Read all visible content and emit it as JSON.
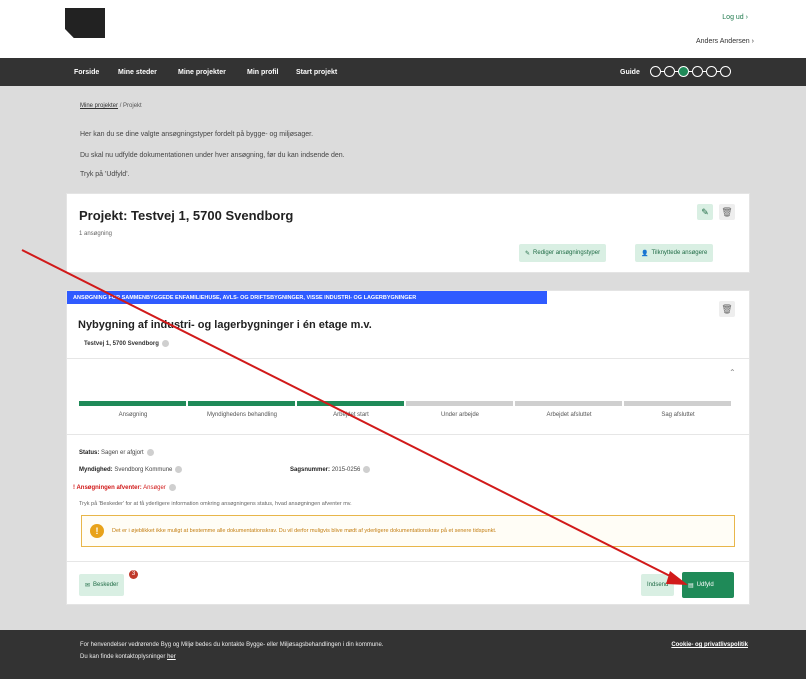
{
  "header": {
    "logout_label": "Log ud",
    "user_name": "Anders Andersen"
  },
  "nav": {
    "items": [
      {
        "label": "Forside"
      },
      {
        "label": "Mine steder"
      },
      {
        "label": "Mine projekter"
      },
      {
        "label": "Min profil"
      },
      {
        "label": "Start projekt"
      }
    ],
    "guide_label": "Guide",
    "guide_steps": 6,
    "guide_active_step": 3
  },
  "breadcrumb": {
    "link": "Mine projekter",
    "separator": "/",
    "current": "Projekt"
  },
  "intro": {
    "line1": "Her kan du se dine valgte ansøgningstyper fordelt på bygge- og miljøsager.",
    "line2": "Du skal nu udfylde dokumentationen under hver ansøgning, før du kan indsende den.",
    "line3": "Tryk på 'Udfyld'."
  },
  "project": {
    "title": "Projekt: Testvej 1, 5700 Svendborg",
    "count": "1 ansøgning",
    "edit_types_label": "Rediger ansøgningstyper",
    "linked_applicants_label": "Tilknyttede ansøgere"
  },
  "application": {
    "banner": "ANSØGNING FOR SAMMENBYGGEDE ENFAMILIEHUSE, AVLS- OG DRIFTSBYGNINGER, VISSE INDUSTRI- OG LAGERBYGNINGER",
    "title": "Nybygning af industri- og lagerbygninger i én etage m.v.",
    "address": "Testvej 1, 5700 Svendborg",
    "progress_steps": [
      {
        "label": "Ansøgning",
        "done": true
      },
      {
        "label": "Myndighedens behandling",
        "done": true
      },
      {
        "label": "Arbejdet start",
        "done": true
      },
      {
        "label": "Under arbejde",
        "done": false
      },
      {
        "label": "Arbejdet afsluttet",
        "done": false
      },
      {
        "label": "Sag afsluttet",
        "done": false
      }
    ],
    "status_label": "Status:",
    "status_value": "Sagen er afgjort",
    "authority_label": "Myndighed:",
    "authority_value": "Svendborg Kommune",
    "case_no_label": "Sagsnummer:",
    "case_no_value": "2015-0256",
    "awaits_label": "! Ansøgningen afventer:",
    "awaits_value": "Ansøger",
    "hint": "Tryk på 'Beskeder' for at få yderligere information omkring ansøgningens status, hvad ansøgningen afventer mv.",
    "warning": "Det er i øjeblikket ikke muligt at bestemme alle dokumentationskrav. Du vil derfor muligvis blive mødt af yderligere dokumentationskrav på et senere tidspunkt.",
    "messages_label": "Beskeder",
    "messages_badge": "3",
    "submit_label": "Indsend",
    "fill_label": "Udfyld"
  },
  "footer": {
    "line1": "For henvendelser vedrørende Byg og Miljø bedes du kontakte Bygge- eller Miljøsagsbehandlingen i din kommune.",
    "line2_prefix": "Du kan finde kontaktoplysninger",
    "line2_link": "her",
    "cookie_link": "Cookie- og privatlivspolitik"
  },
  "colors": {
    "accent_green": "#1f8a58",
    "banner_blue": "#2f5bff",
    "warning_orange": "#e8a21a",
    "annotation_red": "#d11a1a"
  },
  "annotation": {
    "arrow_color": "#d11a1a"
  }
}
